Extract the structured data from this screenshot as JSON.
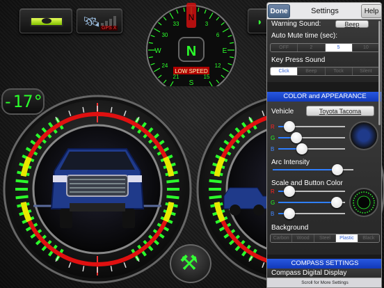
{
  "toolbar": {
    "gps_label": "GPS X"
  },
  "temperature": {
    "value": "-17°"
  },
  "compass": {
    "heading": "N",
    "status": "LOW SPEED",
    "dial_numbers": [
      "33",
      "3",
      "6",
      "12",
      "15",
      "21",
      "24",
      "30"
    ],
    "cardinals": [
      "N",
      "E",
      "S",
      "W"
    ]
  },
  "settings": {
    "done_label": "Done",
    "title": "Settings",
    "help_label": "Help",
    "warning_sound_label": "Warning Sound:",
    "warning_sound_value": "Beep",
    "auto_mute_label": "Auto Mute time (sec):",
    "auto_mute_options": [
      "OFF",
      "2",
      "5",
      "10"
    ],
    "auto_mute_selected": 2,
    "key_press_label": "Key Press Sound",
    "key_press_options": [
      "Click",
      "Beep",
      "Tock",
      "Silent"
    ],
    "key_press_selected": 0,
    "color_header": "COLOR and APPEARANCE",
    "vehicle_label": "Vehicle",
    "vehicle_value": "Toyota Tacoma",
    "vehicle_rgb": {
      "r_label": "R",
      "g_label": "G",
      "b_label": "B",
      "r": 0.1,
      "g": 0.22,
      "b": 0.32
    },
    "arc_intensity_label": "Arc Intensity",
    "arc_intensity": 0.85,
    "scale_color_label": "Scale and Button Color",
    "scale_rgb": {
      "r_label": "R",
      "g_label": "G",
      "b_label": "B",
      "r": 0.1,
      "g": 0.95,
      "b": 0.1
    },
    "background_label": "Background",
    "background_options": [
      "Carbon",
      "Wood",
      "Steel",
      "Plastic",
      "Black"
    ],
    "background_selected": 3,
    "compass_header": "COMPASS SETTINGS",
    "compass_display_label": "Compass Digital Display",
    "footer": "Scroll for More Settings"
  },
  "colors": {
    "accent_green": "#2bff2b",
    "arc_red": "#e01010",
    "arc_yellow": "#e8e800",
    "header_blue": "#1f4fd8",
    "segment_selected_text": "#2f5fd0"
  },
  "icons": {
    "level": "level-icon",
    "gps": "satellite-icon",
    "tools": "wrench-hammer-icon"
  }
}
